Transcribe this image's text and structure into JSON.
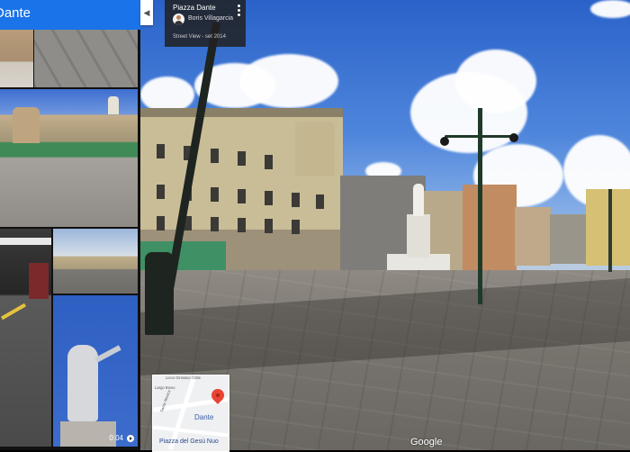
{
  "panel": {
    "title": "Dante",
    "video_duration": "0:04"
  },
  "info_card": {
    "place": "Piazza Dante",
    "author": "Boris Villagarcia",
    "date": "Street View - set 2014"
  },
  "minimap": {
    "place_label": "Dante",
    "bottom_label": "Piazza del Gesù Nuo",
    "street_labels": [
      "Liceo Ginnasio Cotte",
      "Largo Bovio",
      "Santa Monica"
    ]
  },
  "attribution": "Google",
  "colors": {
    "header_blue": "#1a73e8",
    "pin_red": "#e94335",
    "card_bg": "#212121"
  }
}
